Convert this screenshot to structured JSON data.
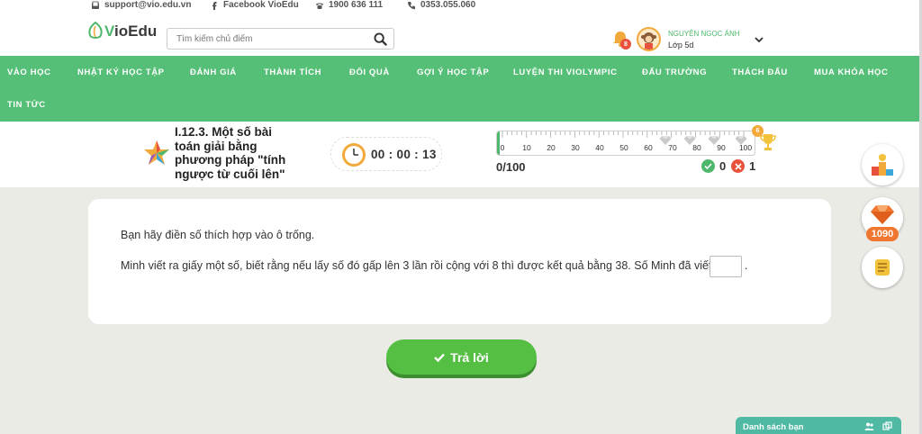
{
  "topbar": {
    "email": "support@vio.edu.vn",
    "facebook": "Facebook VioEdu",
    "phone": "1900 636 111",
    "mobile": "0353.055.060"
  },
  "header": {
    "brand_v": "V",
    "brand_rest": "ioEdu",
    "search_placeholder": "Tìm kiếm chủ điểm",
    "notification_count": "8",
    "user_name": "NGUYỄN NGỌC ÁNH",
    "user_class": "Lớp 5d"
  },
  "nav": {
    "items": [
      "VÀO HỌC",
      "NHẬT KÝ HỌC TẬP",
      "ĐÁNH GIÁ",
      "THÀNH TÍCH",
      "ĐỔI QUÀ",
      "GỢI Ý HỌC TẬP",
      "LUYỆN THI VIOLYMPIC",
      "ĐẤU TRƯỜNG",
      "THÁCH ĐẤU",
      "MUA KHÓA HỌC",
      "TIN TỨC"
    ]
  },
  "lesson": {
    "title": "I.12.3. Một số bài toán giải bằng phương pháp \"tính ngược từ cuối lên\"",
    "timer": "00 : 00 : 13",
    "progress_ticks": [
      "0",
      "10",
      "20",
      "30",
      "40",
      "50",
      "60",
      "70",
      "80",
      "90",
      "100"
    ],
    "progress_value": 0,
    "progress_badge": "6",
    "score": "0/100",
    "correct": "0",
    "wrong": "1",
    "colors": {
      "green": "#55bf77",
      "red": "#e8523c",
      "accent": "#f3a83a"
    }
  },
  "question": {
    "instruction": "Bạn hãy điền số thích hợp vào ô trống.",
    "text": "Minh viết ra giấy một số, biết rằng nếu lấy số đó gấp lên 3 lần rồi cộng với 8 thì được kết quả bằng 38. Số Minh đã viết ra là",
    "answer_value": "",
    "suffix": "."
  },
  "submit": {
    "label": "Trả lời"
  },
  "sidebar": {
    "diamond_count": "1090"
  },
  "friends": {
    "label": "Danh sách bạn"
  }
}
